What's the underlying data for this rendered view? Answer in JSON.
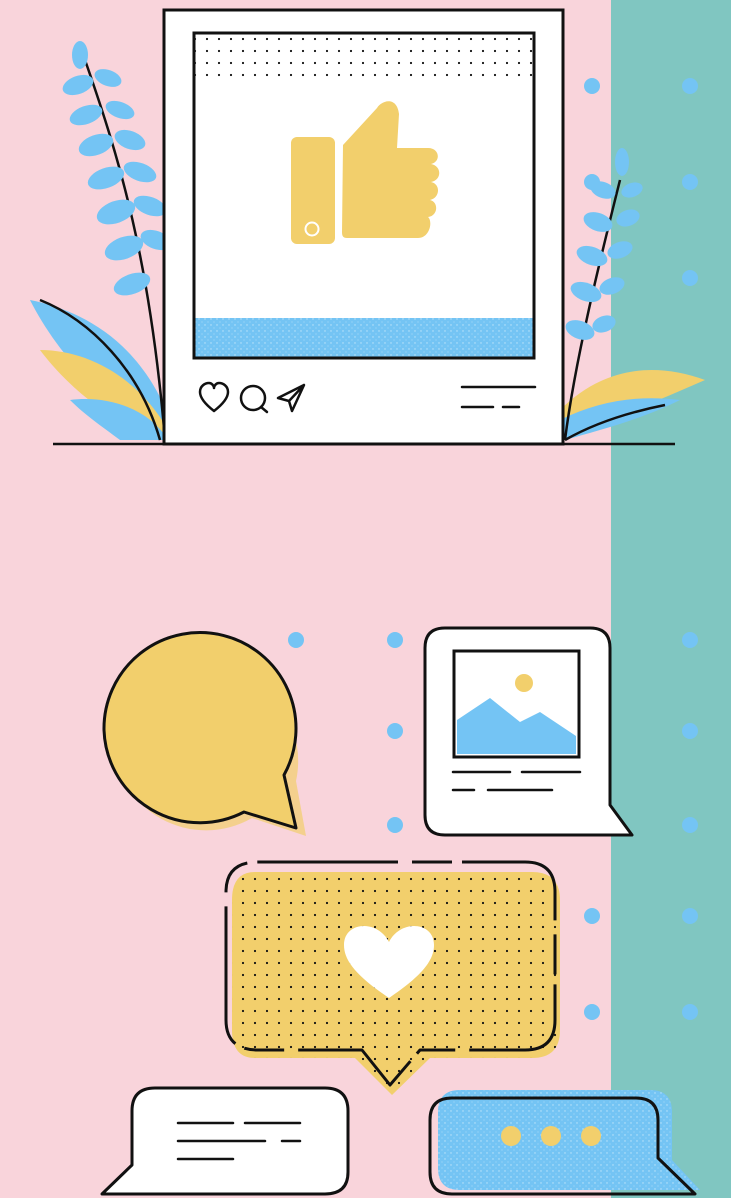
{
  "palette": {
    "pink": "#F9D4DB",
    "teal": "#80C6C1",
    "yellow": "#F2CF6C",
    "blue": "#74C4F4",
    "black": "#111111",
    "white": "#FFFFFF"
  },
  "icons": {
    "post_actions": [
      "heart-icon",
      "comment-icon",
      "send-icon"
    ],
    "post_image": "thumbs-up-icon",
    "chat_bubble_main": "heart-icon",
    "chat_bubble_typing": "typing-dots-icon",
    "chat_bubble_image": "image-icon"
  }
}
